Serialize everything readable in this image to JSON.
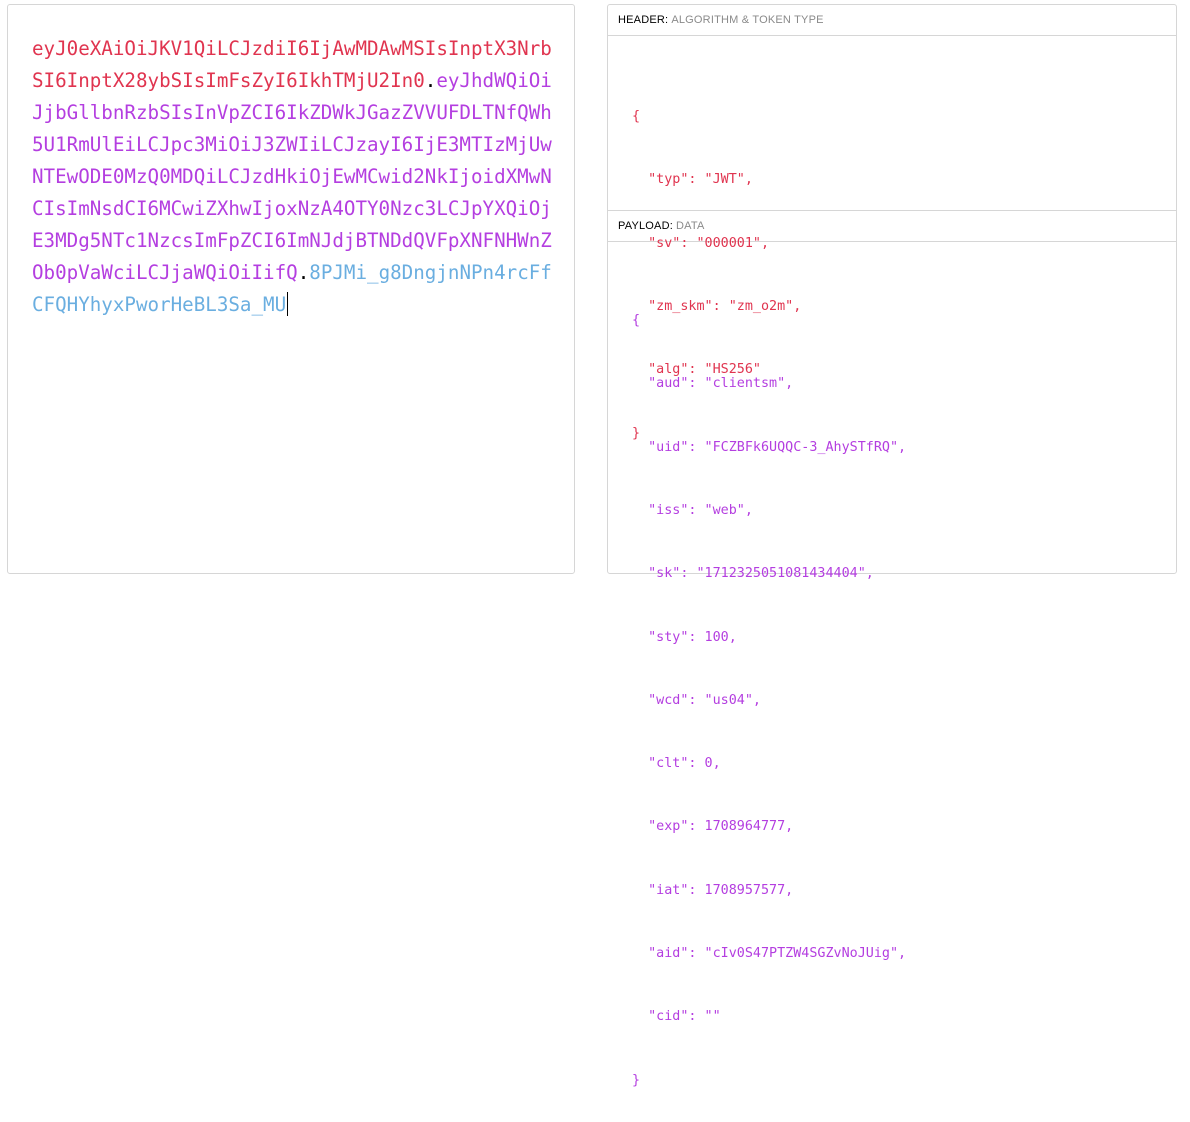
{
  "encoded": {
    "header_part": "eyJ0eXAiOiJKV1QiLCJzdiI6IjAwMDAwMSIsInptX3NrbSI6InptX28ybSIsImFsZyI6IkhTMjU2In0",
    "payload_part": "eyJhdWQiOiJjbGllbnRzbSIsInVpZCI6IkZDWkJGazZVVUFDLTNfQWh5U1RmUlEiLCJpc3MiOiJ3ZWIiLCJzayI6IjE3MTIzMjUwNTEwODE0MzQ0MDQiLCJzdHkiOjEwMCwid2NkIjoidXMwNCIsImNsdCI6MCwiZXhwIjoxNzA4OTY0Nzc3LCJpYXQiOjE3MDg5NTc1NzcsImFpZCI6ImNJdjBTNDdQVFpXNFNHWnZOb0pVaWciLCJjaWQiOiIifQ",
    "signature_part": "8PJMi_g8DngjnNPn4rcFfCFQHYhyxPworHeBL3Sa_MU",
    "separator": "."
  },
  "header_section": {
    "title": "HEADER:",
    "subtitle": "ALGORITHM & TOKEN TYPE",
    "lines": [
      "{",
      "  \"typ\": \"JWT\",",
      "  \"sv\": \"000001\",",
      "  \"zm_skm\": \"zm_o2m\",",
      "  \"alg\": \"HS256\"",
      "}"
    ]
  },
  "payload_section": {
    "title": "PAYLOAD:",
    "subtitle": "DATA",
    "lines": [
      "{",
      "  \"aud\": \"clientsm\",",
      "  \"uid\": \"FCZBFk6UQQC-3_AhySTfRQ\",",
      "  \"iss\": \"web\",",
      "  \"sk\": \"1712325051081434404\",",
      "  \"sty\": 100,",
      "  \"wcd\": \"us04\",",
      "  \"clt\": 0,",
      "  \"exp\": 1708964777,",
      "  \"iat\": 1708957577,",
      "  \"aid\": \"cIv0S47PTZW4SGZvNoJUig\",",
      "  \"cid\": \"\"",
      "}"
    ]
  },
  "colors": {
    "header": "#e0344f",
    "payload": "#b43ee0",
    "signature": "#6aaee0"
  }
}
